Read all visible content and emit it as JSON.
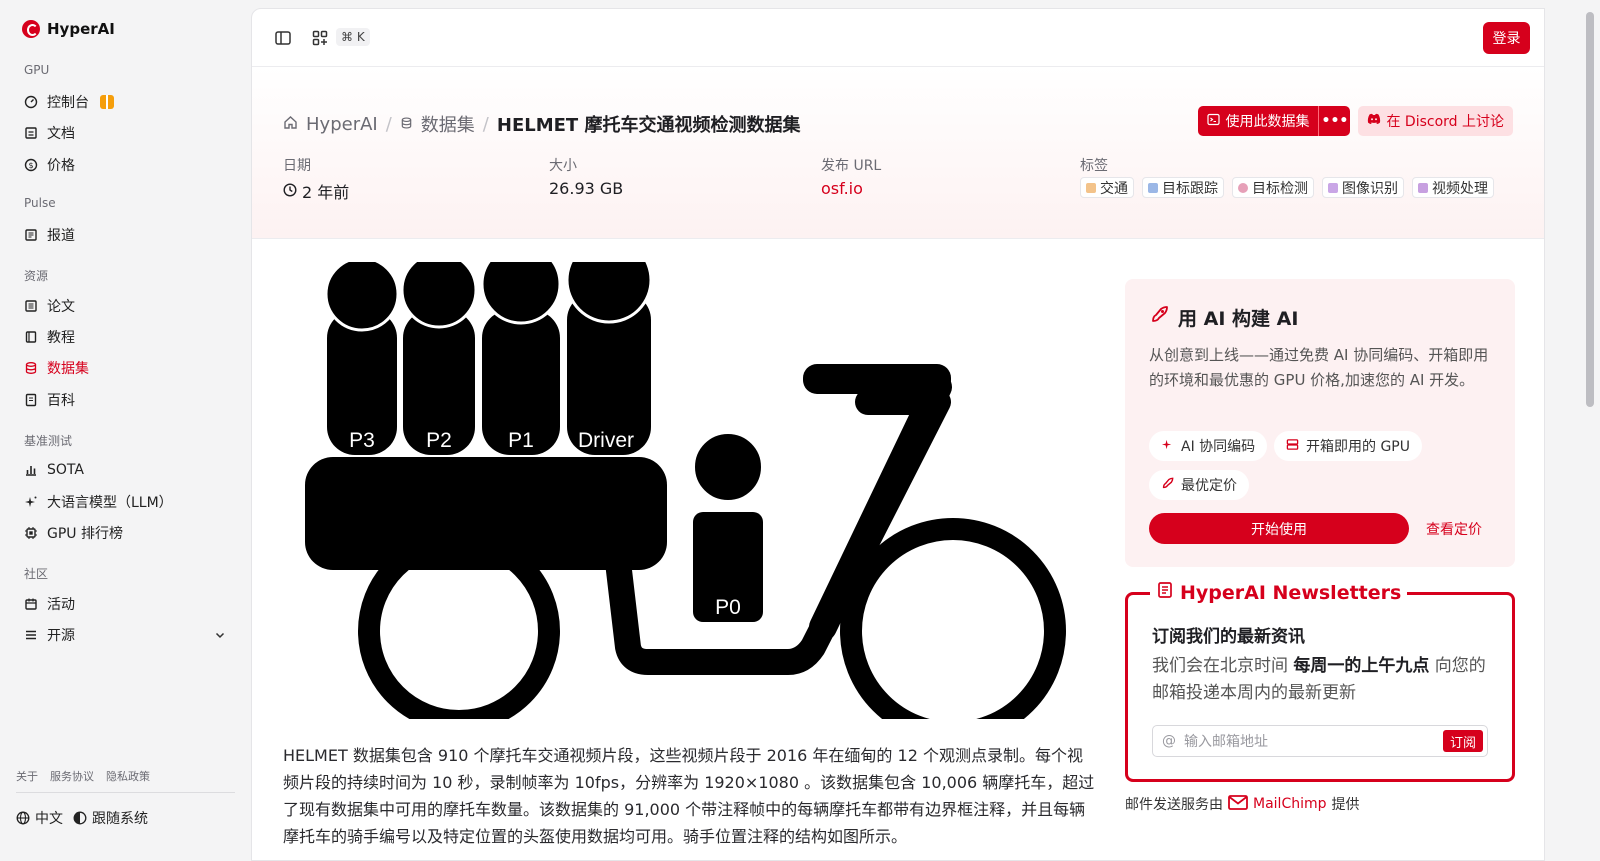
{
  "brand": {
    "name": "HyperAI"
  },
  "sidebar": {
    "sections": [
      {
        "title": "GPU",
        "items": [
          {
            "label": "控制台",
            "icon": "dashboard-icon"
          },
          {
            "label": "文档",
            "icon": "doc-icon"
          },
          {
            "label": "价格",
            "icon": "dollar-icon"
          }
        ]
      },
      {
        "title": "Pulse",
        "items": [
          {
            "label": "报道",
            "icon": "news-icon"
          }
        ]
      },
      {
        "title": "资源",
        "items": [
          {
            "label": "论文",
            "icon": "paper-icon"
          },
          {
            "label": "教程",
            "icon": "tutorial-icon"
          },
          {
            "label": "数据集",
            "icon": "database-icon"
          },
          {
            "label": "百科",
            "icon": "wiki-icon"
          }
        ]
      },
      {
        "title": "基准测试",
        "items": [
          {
            "label": "SOTA",
            "icon": "chart-icon"
          },
          {
            "label": "大语言模型（LLM）",
            "icon": "sparkle-icon"
          },
          {
            "label": "GPU 排行榜",
            "icon": "cpu-icon"
          }
        ]
      },
      {
        "title": "社区",
        "items": [
          {
            "label": "活动",
            "icon": "calendar-icon"
          },
          {
            "label": "开源",
            "icon": "list-icon"
          }
        ]
      }
    ],
    "footer_links": [
      "关于",
      "服务协议",
      "隐私政策"
    ],
    "language": "中文",
    "theme": "跟随系统"
  },
  "topbar": {
    "shortcut": "⌘ K",
    "login": "登录"
  },
  "breadcrumb": {
    "home": "HyperAI",
    "section": "数据集",
    "current": "HELMET 摩托车交通视频检测数据集"
  },
  "actions": {
    "use": "使用此数据集",
    "discord": "在 Discord 上讨论"
  },
  "meta": {
    "date_label": "日期",
    "date_value": "2 年前",
    "size_label": "大小",
    "size_value": "26.93 GB",
    "url_label": "发布 URL",
    "url_value": "osf.io",
    "tags_label": "标签",
    "tags": [
      "交通",
      "目标跟踪",
      "目标检测",
      "图像识别",
      "视频处理"
    ]
  },
  "figure": {
    "labels": [
      "P3",
      "P2",
      "P1",
      "Driver",
      "P0"
    ]
  },
  "description": "HELMET 数据集包含 910 个摩托车交通视频片段，这些视频片段于 2016 年在缅甸的 12 个观测点录制。每个视频片段的持续时间为 10 秒，录制帧率为 10fps，分辨率为 1920×1080 。该数据集包含 10,006 辆摩托车，超过了现有数据集中可用的摩托车数量。该数据集的 91,000 个带注释帧中的每辆摩托车都带有边界框注释，并且每辆摩托车的骑手编号以及特定位置的头盔使用数据均可用。骑手位置注释的结构如图所示。",
  "ai_card": {
    "title": "用 AI 构建 AI",
    "text": "从创意到上线——通过免费 AI 协同编码、开箱即用的环境和最优惠的 GPU 价格,加速您的 AI 开发。",
    "pills": [
      "AI 协同编码",
      "开箱即用的 GPU",
      "最优定价"
    ],
    "start": "开始使用",
    "pricing": "查看定价"
  },
  "newsletter": {
    "title": "HyperAI Newsletters",
    "heading": "订阅我们的最新资讯",
    "text_pre": "我们会在北京时间 ",
    "text_bold": "每周一的上午九点",
    "text_post": " 向您的邮箱投递本周内的最新更新",
    "placeholder": "输入邮箱地址",
    "button": "订阅",
    "provider_pre": "邮件发送服务由",
    "provider": "MailChimp",
    "provider_post": "提供"
  }
}
